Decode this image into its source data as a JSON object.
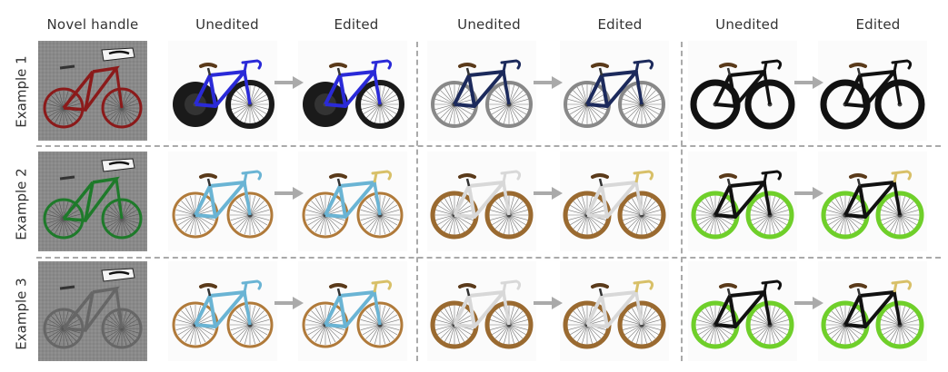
{
  "headers": {
    "novel": "Novel handle",
    "unedited": "Unedited",
    "edited": "Edited"
  },
  "rows": [
    {
      "label": "Example 1"
    },
    {
      "label": "Example 2"
    },
    {
      "label": "Example 3"
    }
  ],
  "colors": {
    "row1": [
      "#2a2ad8",
      "#1c2a5c",
      "#111111"
    ],
    "row2": [
      "#6ab4d4",
      "#d8d8d8",
      "#111111"
    ],
    "row3": [
      "#6ab4d4",
      "#d8d8d8",
      "#111111"
    ],
    "novel": [
      "#8b1a1a",
      "#1e7a2a",
      "#666666"
    ],
    "arrow": "#aaaaaa",
    "divider": "#aaaaaa"
  }
}
